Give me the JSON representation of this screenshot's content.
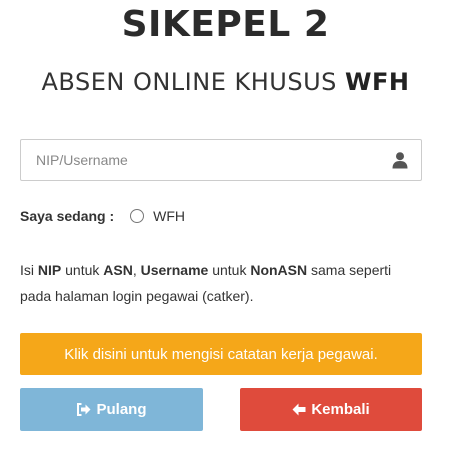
{
  "header": {
    "title": "SIKEPEL 2",
    "subtitle_prefix": "ABSEN ONLINE KHUSUS ",
    "subtitle_bold": "WFH"
  },
  "form": {
    "username_placeholder": "NIP/Username",
    "username_value": "",
    "status_label": "Saya sedang :",
    "status_option": "WFH",
    "status_selected": false
  },
  "help": {
    "t1": "Isi ",
    "b1": "NIP",
    "t2": " untuk ",
    "b2": "ASN",
    "t3": ", ",
    "b3": "Username",
    "t4": " untuk ",
    "b4": "NonASN",
    "t5": " sama seperti pada halaman login pegawai (catker)."
  },
  "buttons": {
    "catatan_label": "Klik disini untuk mengisi catatan kerja pegawai.",
    "pulang_label": "Pulang",
    "kembali_label": "Kembali"
  },
  "icons": {
    "user": "user-icon",
    "signout": "sign-out-icon",
    "back": "arrow-left-icon"
  },
  "colors": {
    "catatan": "#f5a719",
    "pulang": "#7fb6d8",
    "kembali": "#df4b3c"
  }
}
